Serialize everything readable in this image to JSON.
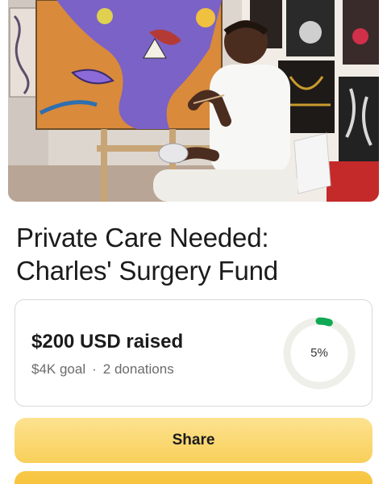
{
  "hero": {
    "image_alt": "Artist painting in a studio surrounded by artwork"
  },
  "campaign": {
    "title_line1": "Private Care Needed:",
    "title_line2": "Charles' Surgery Fund"
  },
  "progress": {
    "raised_text": "$200 USD raised",
    "goal_text": "$4K goal",
    "separator": "·",
    "donations_text": "2 donations",
    "percent_text": "5%",
    "fraction": 0.05,
    "ring_color": "#0fa954",
    "track_color": "#efefe9"
  },
  "actions": {
    "share_label": "Share",
    "donate_label": ""
  },
  "colors": {
    "button_yellow": "#fad66e",
    "button_yellow_dark": "#f5bb2b"
  }
}
